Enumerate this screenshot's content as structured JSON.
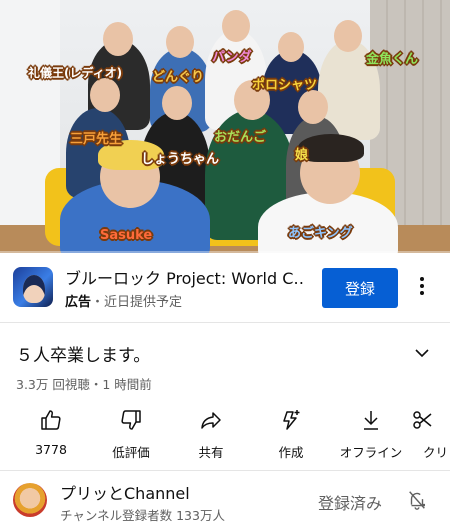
{
  "video": {
    "name_tags": [
      {
        "text": "礼儀王(レディオ)",
        "color": "#ffffff"
      },
      {
        "text": "どんぐり",
        "color": "#f7c74a"
      },
      {
        "text": "パンダ",
        "color": "#f088d8"
      },
      {
        "text": "金魚くん",
        "color": "#8fe35c"
      },
      {
        "text": "ポロシャツ",
        "color": "#f7d13a"
      },
      {
        "text": "三戸先生",
        "color": "#f7a03a"
      },
      {
        "text": "しょうちゃん",
        "color": "#ffffff"
      },
      {
        "text": "おだんご",
        "color": "#a8e05a"
      },
      {
        "text": "娘",
        "color": "#f5e04a"
      },
      {
        "text": "Sasuke",
        "color": "#ff6a3a"
      },
      {
        "text": "あごキング",
        "color": "#8ec5ff"
      }
    ]
  },
  "ad": {
    "title": "ブルーロック Project: World C…",
    "label": "広告",
    "sub": "・近日提供予定",
    "button": "登録"
  },
  "video_info": {
    "title": "５人卒業します。",
    "meta": "3.3万 回視聴・1 時間前"
  },
  "actions": [
    {
      "label": "3778",
      "icon": "thumbs-up-icon"
    },
    {
      "label": "低評価",
      "icon": "thumbs-down-icon"
    },
    {
      "label": "共有",
      "icon": "share-icon"
    },
    {
      "label": "作成",
      "icon": "create-icon"
    },
    {
      "label": "オフライン",
      "icon": "download-icon"
    },
    {
      "label": "クリ",
      "icon": "clip-icon"
    }
  ],
  "channel": {
    "name": "プリッとChannel",
    "subscribers": "チャンネル登録者数 133万人",
    "subscribe_state": "登録済み"
  },
  "colors": {
    "accent": "#065fd4",
    "secondary_text": "#606060",
    "progress": "#ff0000"
  }
}
